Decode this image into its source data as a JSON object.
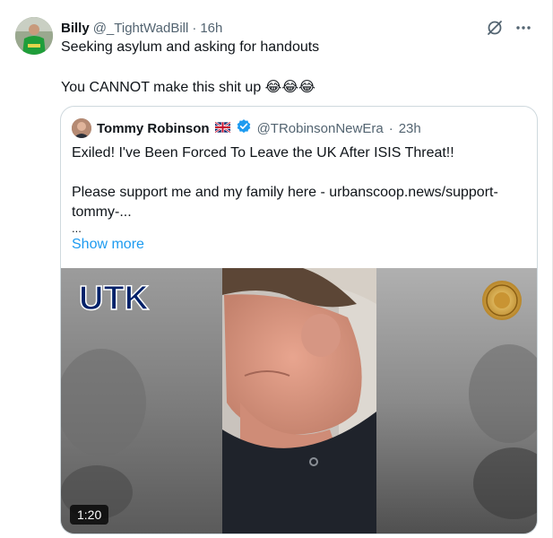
{
  "tweet": {
    "author_name": "Billy",
    "author_handle": "@_TightWadBill",
    "separator": "·",
    "time": "16h",
    "line1": "Seeking asylum and asking for handouts",
    "line2": "You CANNOT make this shit up",
    "line2_emoji": "😂😂😂"
  },
  "icons": {
    "grok": "grok-icon",
    "more": "more-icon",
    "flag": "uk-flag-icon",
    "verified": "verified-badge-icon"
  },
  "quote": {
    "author_name": "Tommy Robinson",
    "author_handle": "@TRobinsonNewEra",
    "separator": "·",
    "time": "23h",
    "line1": "Exiled! I've Been Forced To Leave the UK After ISIS Threat!!",
    "line2": "Please support me and my family here - urbanscoop.news/support-",
    "line3": "tommy-...",
    "line4": "...",
    "show_more": "Show more"
  },
  "video": {
    "duration": "1:20",
    "logo_text": "UTK"
  },
  "colors": {
    "link": "#1d9bf0",
    "text": "#0f1419",
    "secondary": "#536471",
    "verified": "#1d9bf0",
    "border": "#cfd9de"
  }
}
